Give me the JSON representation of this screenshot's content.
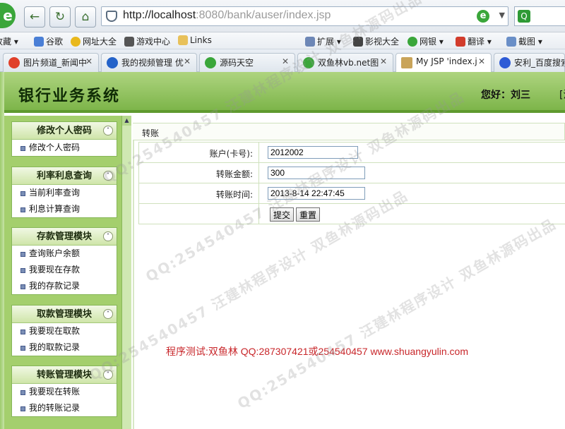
{
  "browser": {
    "url_host": "http://localhost",
    "url_rest": ":8080/bank/auser/index.jsp",
    "favorites": [
      {
        "label": "收藏",
        "icon": "star-icon"
      },
      {
        "label": "谷歌",
        "icon": "google-icon"
      },
      {
        "label": "网址大全",
        "icon": "globe-icon"
      },
      {
        "label": "游戏中心",
        "icon": "gamepad-icon"
      },
      {
        "label": "Links",
        "icon": "folder-icon"
      },
      {
        "label": "扩展",
        "icon": "extension-icon"
      },
      {
        "label": "影视大全",
        "icon": "film-icon"
      },
      {
        "label": "网银",
        "icon": "bank-icon"
      },
      {
        "label": "翻译",
        "icon": "translate-icon"
      },
      {
        "label": "截图",
        "icon": "scissors-icon"
      }
    ],
    "tabs": [
      {
        "label": "图片频道_新闻中",
        "color": "#e0402a"
      },
      {
        "label": "我的视频管理 优",
        "color": "#2563c9"
      },
      {
        "label": "源码天空",
        "color": "#3aa63a"
      },
      {
        "label": "双鱼林vb.net图",
        "color": "#3aa63a"
      },
      {
        "label": "My JSP 'index.j",
        "color": "#c9a45a"
      },
      {
        "label": "安利_百度搜索",
        "color": "#2e5bd6"
      }
    ]
  },
  "header": {
    "title": "银行业务系统",
    "greeting": "您好：刘三",
    "logout_partial": "[注"
  },
  "sidebar": {
    "menus": [
      {
        "title": "修改个人密码",
        "items": [
          "修改个人密码"
        ]
      },
      {
        "title": "利率利息查询",
        "items": [
          "当前利率查询",
          "利息计算查询"
        ]
      },
      {
        "title": "存款管理模块",
        "items": [
          "查询账户余额",
          "我要现在存款",
          "我的存款记录"
        ]
      },
      {
        "title": "取款管理模块",
        "items": [
          "我要现在取款",
          "我的取款记录"
        ]
      },
      {
        "title": "转账管理模块",
        "items": [
          "我要现在转账",
          "我的转账记录"
        ]
      }
    ]
  },
  "main": {
    "breadcrumb": "转账",
    "form": {
      "account_label": "账户(卡号):",
      "account_value": "2012002",
      "amount_label": "转账金额:",
      "amount_value": "300",
      "time_label": "转账时间:",
      "time_value": "2013-8-14 22:47:45",
      "submit_label": "提交",
      "reset_label": "重置"
    },
    "footer_note": "程序测试:双鱼林 QQ:287307421或254540457 www.shuangyulin.com"
  },
  "watermark": "QQ:254540457 汪建林程序设计 双鱼林源码出品"
}
